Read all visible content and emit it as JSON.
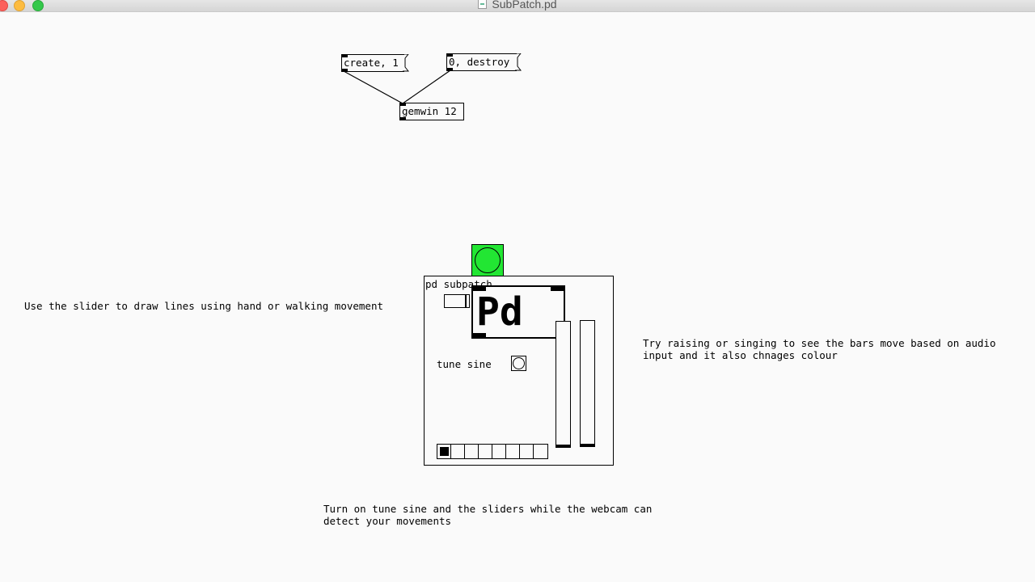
{
  "window": {
    "title": "SubPatch.pd",
    "traffic_lights": {
      "close": "#fc605c",
      "minimize": "#fdbc40",
      "zoom": "#34c84a"
    }
  },
  "patch": {
    "msg_create": "create, 1",
    "msg_destroy": "0, destroy",
    "obj_gemwin": "gemwin 12",
    "subpatch_label": "pd subpatch",
    "pd_logo": "Pd",
    "tune_sine_label": "tune sine",
    "bang_color": "#22e633"
  },
  "comments": {
    "slider_hint": "Use the slider to draw lines using hand or walking movement",
    "bars_hint_line1": "Try raising or singing to see the bars move based on audio",
    "bars_hint_line2": "input and it also chnages colour",
    "bottom_hint_line1": "Turn on tune sine and the sliders while the webcam can",
    "bottom_hint_line2": "detect your movements"
  }
}
